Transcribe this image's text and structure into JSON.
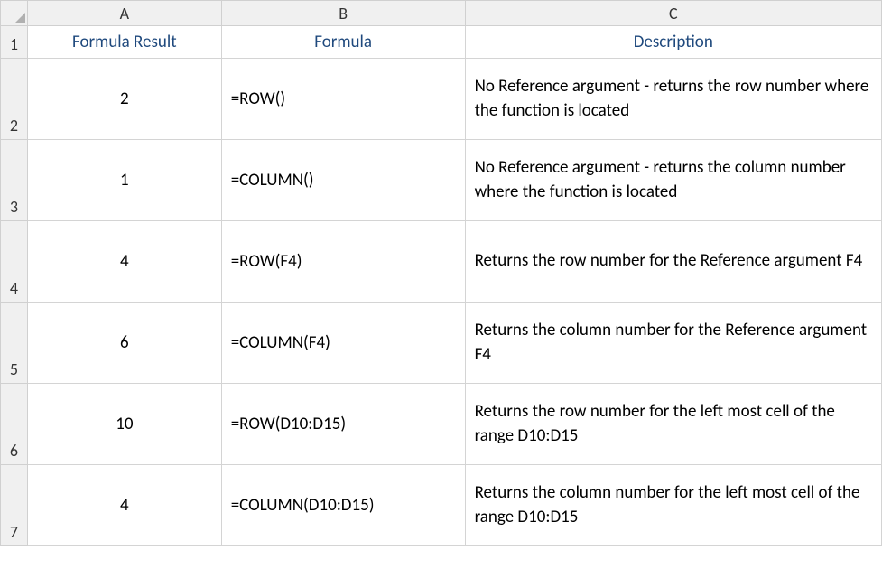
{
  "columns": [
    "A",
    "B",
    "C"
  ],
  "rowNumbers": [
    "1",
    "2",
    "3",
    "4",
    "5",
    "6",
    "7"
  ],
  "headers": {
    "a": "Formula Result",
    "b": "Formula",
    "c": "Description"
  },
  "rows": [
    {
      "result": "2",
      "formula": "=ROW()",
      "description": "No Reference argument - returns the row number where the function is located"
    },
    {
      "result": "1",
      "formula": "=COLUMN()",
      "description": "No Reference argument - returns the column number where the function is located"
    },
    {
      "result": "4",
      "formula": "=ROW(F4)",
      "description": "Returns the row number for the Reference argument F4"
    },
    {
      "result": "6",
      "formula": "=COLUMN(F4)",
      "description": "Returns the column number for the Reference argument F4"
    },
    {
      "result": "10",
      "formula": "=ROW(D10:D15)",
      "description": "Returns the row number for the left most cell of the range D10:D15"
    },
    {
      "result": "4",
      "formula": "=COLUMN(D10:D15)",
      "description": "Returns the column number for the left most cell of the range D10:D15"
    }
  ]
}
